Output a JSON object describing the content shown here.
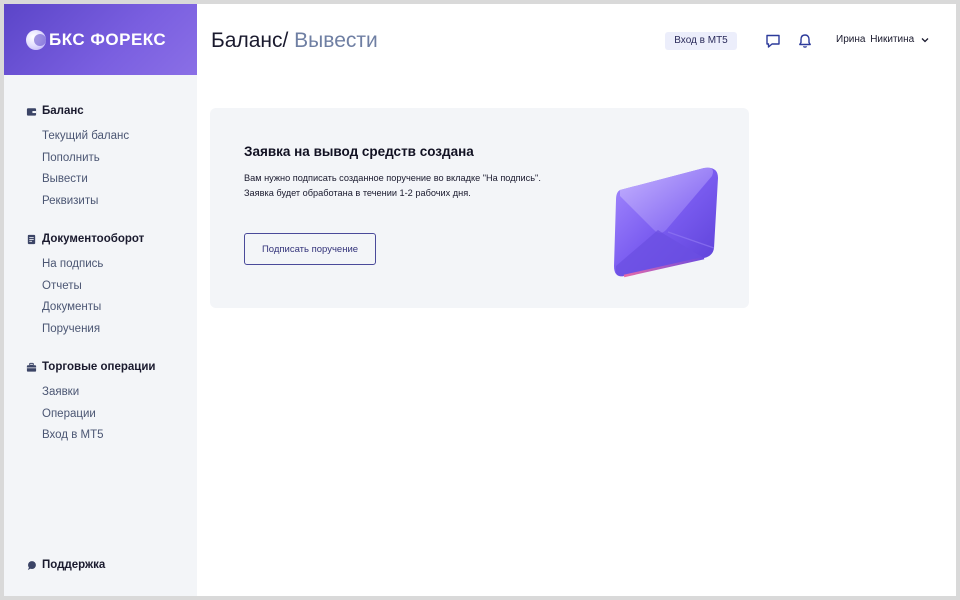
{
  "brand": {
    "name": "БКС ФОРЕКС"
  },
  "header": {
    "title": "Баланс/",
    "breadcrumb": "Вывести",
    "mt5_button": "Вход в МТ5",
    "user_name": "Ирина  Никитина",
    "icons": [
      "chat-icon",
      "bell-icon",
      "chevron-down-icon"
    ]
  },
  "sidebar": {
    "groups": [
      {
        "label": "Баланс",
        "icon": "wallet-icon",
        "items": [
          "Текущий баланс",
          "Пополнить",
          "Вывести",
          "Реквизиты"
        ]
      },
      {
        "label": "Документооборот",
        "icon": "document-icon",
        "items": [
          "На подпись",
          "Отчеты",
          "Документы",
          "Поручения"
        ]
      },
      {
        "label": "Торговые операции",
        "icon": "briefcase-icon",
        "items": [
          "Заявки",
          "Операции",
          "Вход в МТ5"
        ]
      }
    ],
    "support": "Поддержка"
  },
  "card": {
    "title": "Заявка на вывод средств создана",
    "line1": "Вам нужно подписать созданное поручение во вкладке \"На подпись\".",
    "line2": "Заявка будет обработана в течении 1-2 рабочих дня.",
    "button": "Подписать поручение"
  },
  "colors": {
    "accent": "#5b45c8",
    "sidebar_bg": "#f3f5f8",
    "card_bg": "#f3f5f8",
    "crumb": "#6f7fa3"
  }
}
